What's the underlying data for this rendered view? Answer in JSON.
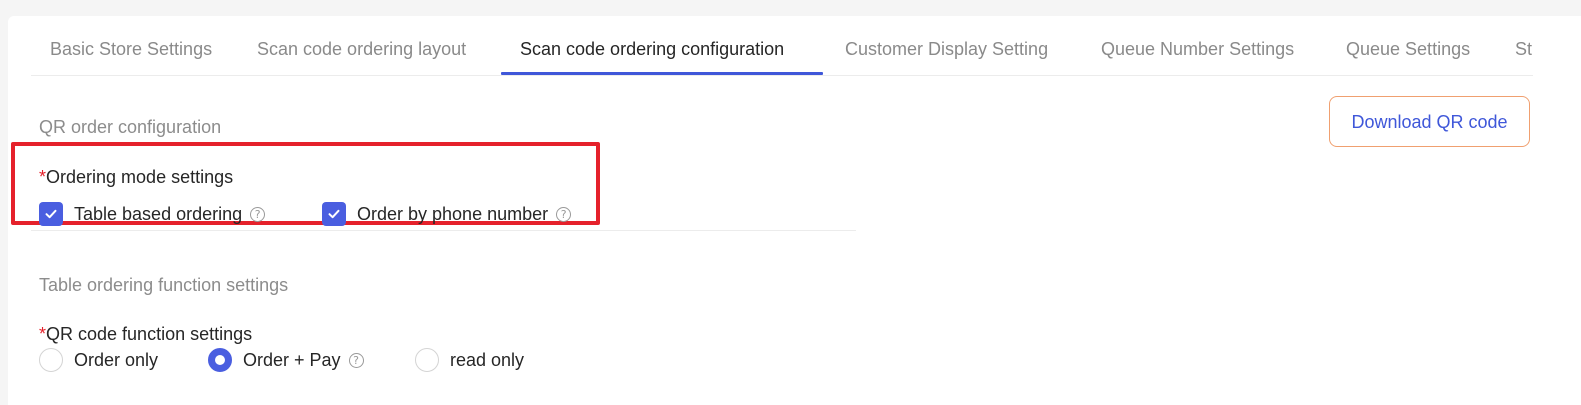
{
  "tabs": [
    {
      "label": "Basic Store Settings"
    },
    {
      "label": "Scan code ordering layout"
    },
    {
      "label": "Scan code ordering configuration",
      "active": true
    },
    {
      "label": "Customer Display Setting"
    },
    {
      "label": "Queue Number Settings"
    },
    {
      "label": "Queue Settings"
    },
    {
      "label": "St"
    }
  ],
  "qr_config": {
    "title": "QR order configuration",
    "download_label": "Download QR code"
  },
  "ordering_mode": {
    "required_mark": "*",
    "label": "Ordering mode settings",
    "options": [
      {
        "label": "Table based ordering",
        "checked": true,
        "help": "?"
      },
      {
        "label": "Order by phone number",
        "checked": true,
        "help": "?"
      }
    ]
  },
  "table_ordering": {
    "title": "Table ordering function settings",
    "qr_function": {
      "required_mark": "*",
      "label": "QR code function settings",
      "options": [
        {
          "label": "Order only",
          "selected": false
        },
        {
          "label": "Order + Pay",
          "selected": true,
          "help": "?"
        },
        {
          "label": "read only",
          "selected": false
        }
      ]
    }
  },
  "colors": {
    "accent": "#3f57d9",
    "checkbox": "#4a5ee0",
    "required": "#e5212b",
    "highlight": "#e5212b",
    "button_border": "#f0a070"
  },
  "icons": {
    "checkbox": "check-icon",
    "help": "question-circle-icon"
  }
}
